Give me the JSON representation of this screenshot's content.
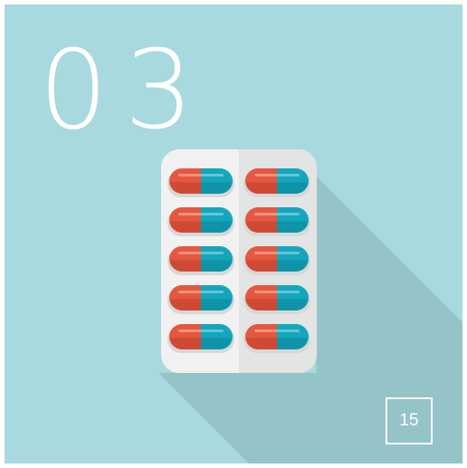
{
  "title": {
    "number": "03"
  },
  "footer": {
    "page_number": "15"
  },
  "colors": {
    "background": "#a8d9de",
    "shadow": "#94c3c8",
    "blister_pack": "#f1f1f1",
    "blister_pack_right": "#e3e4e4",
    "capsule_red": "#e5573f",
    "capsule_red_dark": "#cf4a34",
    "capsule_teal": "#14a6bd",
    "capsule_teal_dark": "#0f93a8",
    "text": "#ffffff"
  },
  "illustration": {
    "type": "blister-pack-of-capsules",
    "columns": 2,
    "rows": 5,
    "capsule_count": 10
  }
}
